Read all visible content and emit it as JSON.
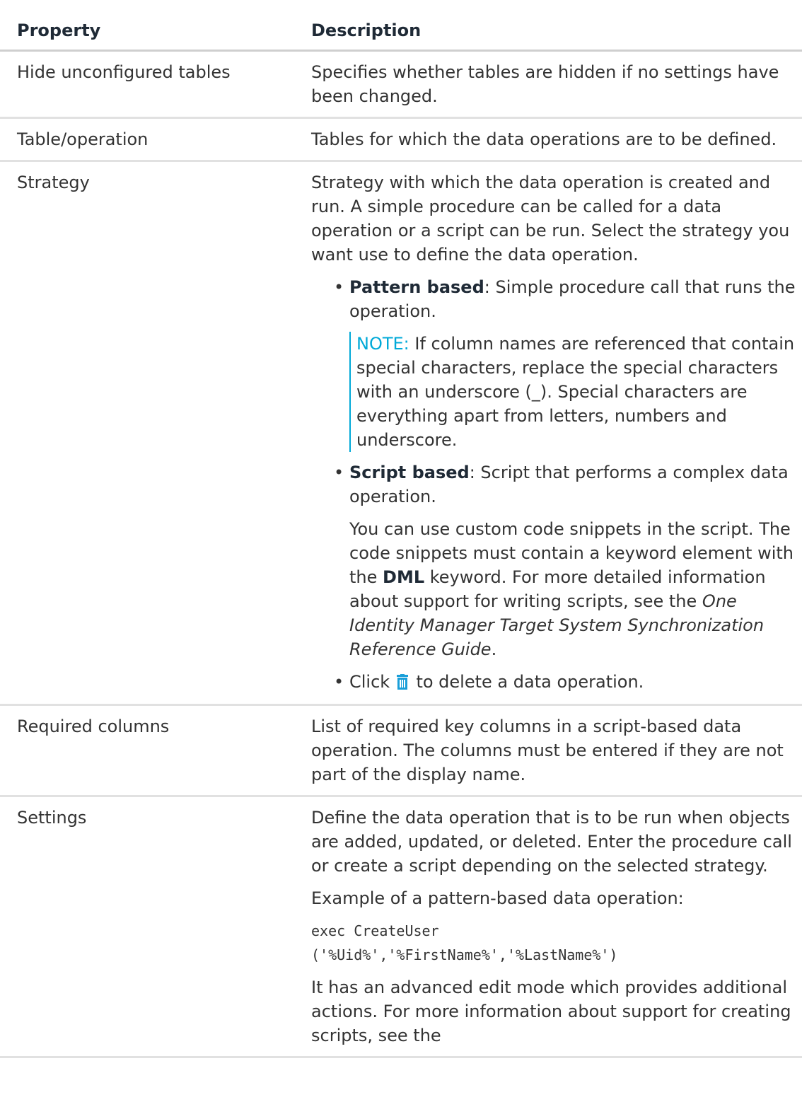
{
  "header": {
    "property": "Property",
    "description": "Description"
  },
  "rows": {
    "hide": {
      "property": "Hide unconfigured tables",
      "desc": "Specifies whether tables are hidden if no settings have been changed."
    },
    "table": {
      "property": "Table/operation",
      "desc": "Tables for which the data operations are to be defined."
    },
    "strategy": {
      "property": "Strategy",
      "desc": "Strategy with which the data operation is created and run. A simple procedure can be called for a data operation or a script can be run. Select the strategy you want use to define the data operation.",
      "pattern_label": "Pattern based",
      "pattern_text": ": Simple procedure call that runs the operation.",
      "note_label": "NOTE:",
      "note_text": " If column names are referenced that contain special characters, replace the special characters with an underscore (_). Special characters are everything apart from letters, numbers and underscore.",
      "script_label": "Script based",
      "script_text": ": Script that performs a complex data operation.",
      "snip_a": "You can use custom code snippets in the script. The code snippets must contain a keyword element with the ",
      "snip_kw": "DML",
      "snip_b": " keyword. For more detailed information about support for writing scripts, see the ",
      "snip_guide": "One Identity Manager Target System Synchronization Reference Guide",
      "snip_end": ".",
      "click_a": "Click ",
      "click_b": " to delete a data operation."
    },
    "required": {
      "property": "Required columns",
      "desc": "List of required key columns in a script-based data operation. The columns must be entered if they are not part of the display name."
    },
    "settings": {
      "property": "Settings",
      "desc": "Define the data operation that is to be run when objects are added, updated, or deleted. Enter the procedure call or create a script depending on the selected strategy.",
      "example_label": "Example of a pattern-based data operation:",
      "code_1": "exec CreateUser",
      "code_2": "('%Uid%','%FirstName%','%LastName%')",
      "advanced": "It has an advanced edit mode which provides additional actions. For more information about support for creating scripts, see the"
    }
  },
  "colors": {
    "trash_icon": "#1a9fd9",
    "note_accent": "#00a9d8"
  }
}
